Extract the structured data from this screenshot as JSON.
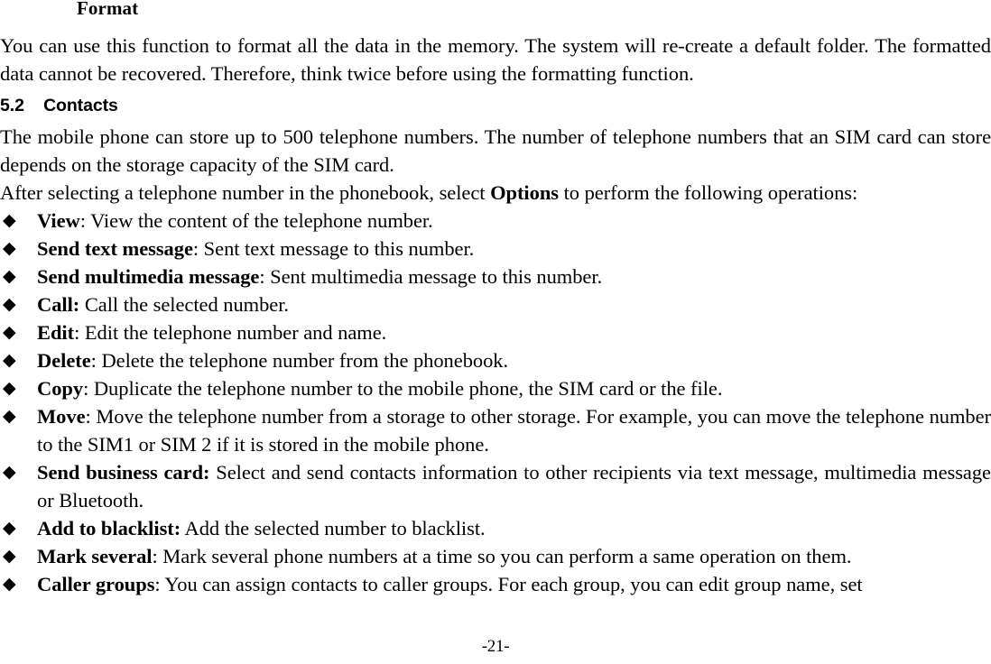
{
  "document": {
    "subheading": "Format",
    "intro_paragraph": "You can use this function to format all the data in the memory. The system will re-create a default folder. The formatted data cannot be recovered. Therefore, think twice before using the formatting function.",
    "section": {
      "number": "5.2",
      "title": "Contacts",
      "heading_full": "5.2    Contacts"
    },
    "body_paragraph_1": "The mobile phone can store up to 500 telephone numbers. The number of telephone numbers that an SIM card can store depends on the storage capacity of the SIM card.",
    "body_paragraph_2_before": "After selecting a telephone number in the phonebook, select ",
    "body_paragraph_2_bold": "Options",
    "body_paragraph_2_after": " to perform the following operations:",
    "bullet_glyph": "◆",
    "options": [
      {
        "term": "View",
        "separator": ": ",
        "description": "View the content of the telephone number."
      },
      {
        "term": "Send text message",
        "separator": ": ",
        "description": "Sent text message to this number."
      },
      {
        "term": "Send multimedia message",
        "separator": ": ",
        "description": "Sent multimedia message to this number."
      },
      {
        "term": "Call:",
        "separator": " ",
        "description": "Call the selected number."
      },
      {
        "term": "Edit",
        "separator": ": ",
        "description": "Edit the telephone number and name."
      },
      {
        "term": "Delete",
        "separator": ": ",
        "description": "Delete the telephone number from the phonebook."
      },
      {
        "term": "Copy",
        "separator": ": ",
        "description": "Duplicate the telephone number to the mobile phone, the SIM card or the file."
      },
      {
        "term": "Move",
        "separator": ": ",
        "description": "Move the telephone number from a storage to other storage. For example, you can move the telephone number to the SIM1 or SIM 2 if it is stored in the mobile phone."
      },
      {
        "term": "Send business card:",
        "separator": " ",
        "description": "Select and send contacts information to other recipients via text message, multimedia message or Bluetooth."
      },
      {
        "term": "Add to blacklist:",
        "separator": " ",
        "description": "Add the selected number to blacklist."
      },
      {
        "term": "Mark several",
        "separator": ": ",
        "description": "Mark several phone numbers at a time so you can perform a same operation on them."
      },
      {
        "term": "Caller groups",
        "separator": ": ",
        "description": "You can assign contacts to caller groups. For each group, you can edit group name, set"
      }
    ],
    "page_number": "-21-"
  }
}
